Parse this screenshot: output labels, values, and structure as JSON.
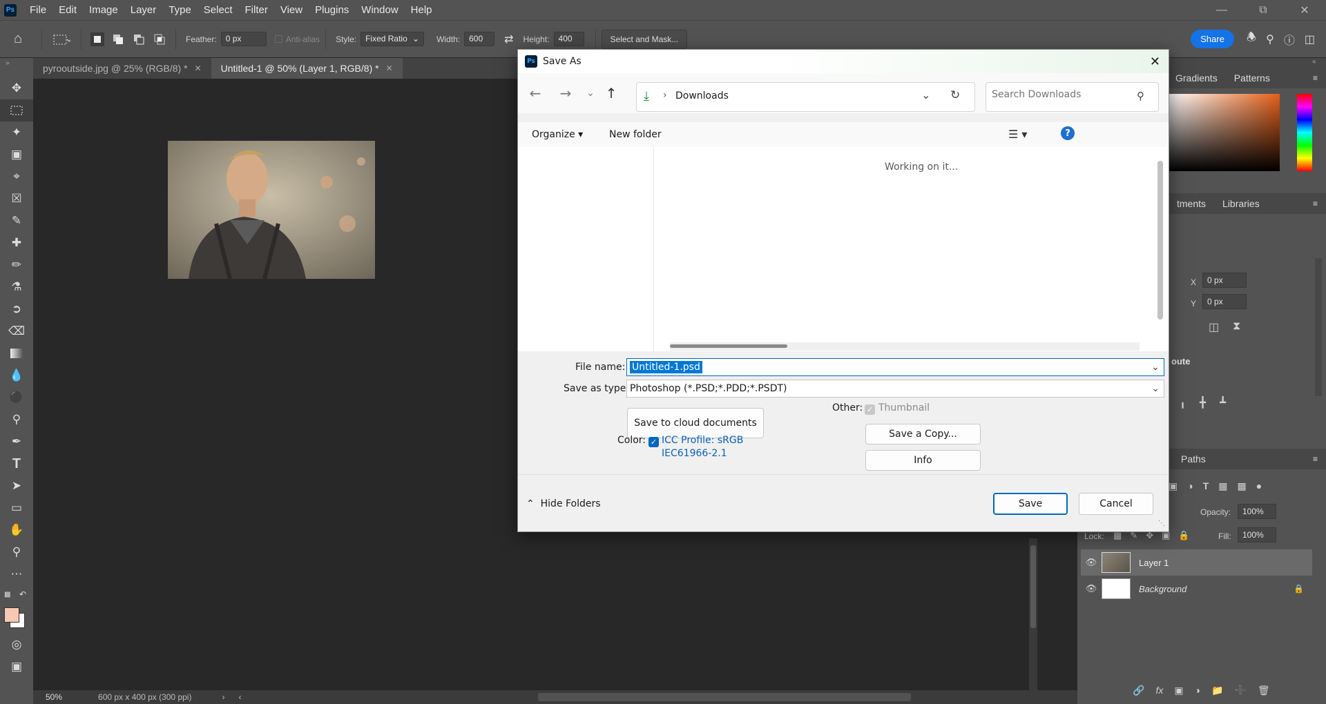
{
  "app": {
    "logo": "Ps",
    "menu": [
      "File",
      "Edit",
      "Image",
      "Layer",
      "Type",
      "Select",
      "Filter",
      "View",
      "Plugins",
      "Window",
      "Help"
    ]
  },
  "options": {
    "feather_label": "Feather:",
    "feather_value": "0 px",
    "antialias_label": "Anti-alias",
    "style_label": "Style:",
    "style_value": "Fixed Ratio",
    "width_label": "Width:",
    "width_value": "600",
    "height_label": "Height:",
    "height_value": "400",
    "select_mask": "Select and Mask...",
    "share": "Share"
  },
  "tabs": [
    {
      "label": "pyrooutside.jpg @ 25% (RGB/8) *"
    },
    {
      "label": "Untitled-1 @ 50% (Layer 1, RGB/8) *"
    }
  ],
  "status": {
    "zoom": "50%",
    "doc_size": "600 px x 400 px (300 ppi)"
  },
  "panels": {
    "color_tabs": [
      "Gradients",
      "Patterns"
    ],
    "props_tabs": [
      "tments",
      "Libraries"
    ],
    "x_label": "X",
    "x_value": "0 px",
    "y_label": "Y",
    "y_value": "0 px",
    "section": "oute",
    "layers_tab": "Paths",
    "opacity_label": "Opacity:",
    "opacity_value": "100%",
    "lock_label": "Lock:",
    "fill_label": "Fill:",
    "fill_value": "100%",
    "layers": [
      {
        "name": "Layer 1"
      },
      {
        "name": "Background"
      }
    ]
  },
  "dialog": {
    "title": "Save As",
    "breadcrumb": "Downloads",
    "search_placeholder": "Search Downloads",
    "organize": "Organize",
    "new_folder": "New folder",
    "working": "Working on it...",
    "file_name_label": "File name:",
    "file_name_value": "Untitled-1.psd",
    "save_type_label": "Save as type:",
    "save_type_value": "Photoshop (*.PSD;*.PDD;*.PSDT)",
    "cloud_button": "Save to cloud documents",
    "color_label": "Color:",
    "icc_line1": "ICC Profile:  sRGB",
    "icc_line2": "IEC61966-2.1",
    "other_label": "Other:",
    "thumbnail": "Thumbnail",
    "save_copy": "Save a Copy...",
    "info": "Info",
    "hide_folders": "Hide Folders",
    "save": "Save",
    "cancel": "Cancel"
  },
  "colors": {
    "accent": "#1473e6",
    "dialog_primary": "#0067c0",
    "foreground_swatch": "#f6c8b4",
    "background_swatch": "#ffffff"
  }
}
